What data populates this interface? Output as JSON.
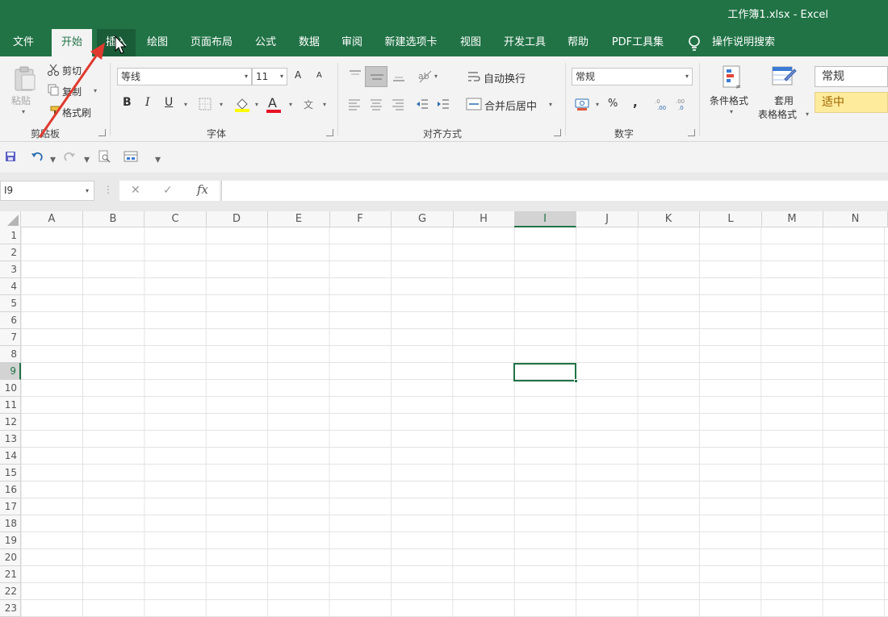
{
  "titlebar": {
    "title": "工作簿1.xlsx  -  Excel"
  },
  "tabs": {
    "file": "文件",
    "home": "开始",
    "insert": "插入",
    "draw": "绘图",
    "page_layout": "页面布局",
    "formulas": "公式",
    "data": "数据",
    "review": "审阅",
    "new_tab": "新建选项卡",
    "view": "视图",
    "developer": "开发工具",
    "help": "帮助",
    "pdf": "PDF工具集",
    "tell_me": "操作说明搜索"
  },
  "ribbon": {
    "clipboard": {
      "paste": "粘贴",
      "cut": "剪切",
      "copy": "复制",
      "format_painter": "格式刷",
      "label": "剪贴板"
    },
    "font": {
      "font_name": "等线",
      "font_size": "11",
      "grow": "A",
      "shrink": "A",
      "bold": "B",
      "italic": "I",
      "underline": "U",
      "font_color": "A",
      "phonetic": "文",
      "label": "字体"
    },
    "alignment": {
      "wrap_text": "自动换行",
      "merge_center": "合并后居中",
      "label": "对齐方式"
    },
    "number": {
      "format": "常规",
      "percent": "%",
      "comma": ",",
      "label": "数字"
    },
    "styles": {
      "conditional_formatting": "条件格式",
      "format_as_table_1": "套用",
      "format_as_table_2": "表格格式",
      "style_normal": "常规",
      "style_neutral": "适中"
    }
  },
  "formula_bar": {
    "name_box": "I9",
    "fx": "fx",
    "cancel": "✕",
    "enter": "✓"
  },
  "grid": {
    "columns": [
      "A",
      "B",
      "C",
      "D",
      "E",
      "F",
      "G",
      "H",
      "I",
      "J",
      "K",
      "L",
      "M",
      "N"
    ],
    "rows": [
      "1",
      "2",
      "3",
      "4",
      "5",
      "6",
      "7",
      "8",
      "9",
      "10",
      "11",
      "12",
      "13",
      "14",
      "15",
      "16",
      "17",
      "18",
      "19",
      "20",
      "21",
      "22",
      "23"
    ],
    "selected_column": "I",
    "selected_row": "9"
  },
  "colors": {
    "brand_green": "#217346",
    "annotation_red": "#e03a2f",
    "neutral_style_bg": "#ffeb9c",
    "neutral_style_text": "#9c6500"
  }
}
